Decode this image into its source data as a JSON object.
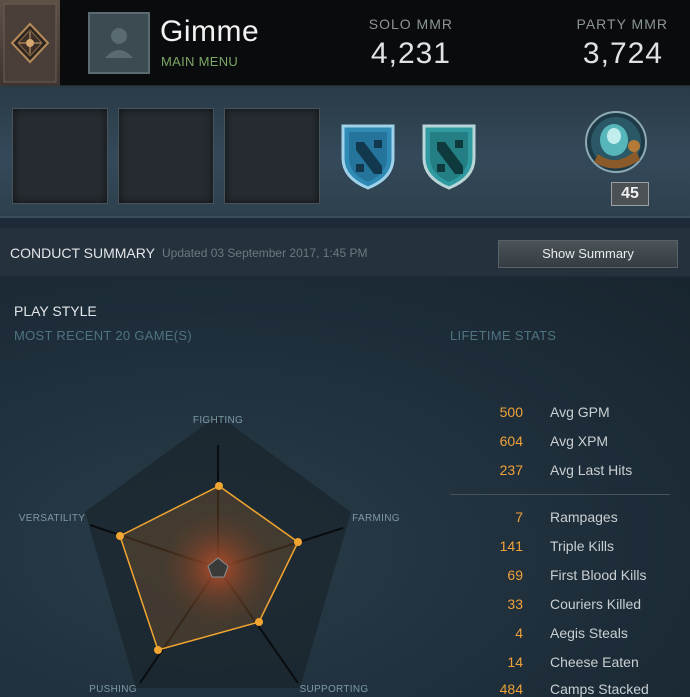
{
  "header": {
    "player_name": "Gimme",
    "status": "MAIN MENU",
    "solo_mmr_label": "SOLO MMR",
    "solo_mmr_value": "4,231",
    "party_mmr_label": "PARTY MMR",
    "party_mmr_value": "3,724"
  },
  "badges": {
    "hero_level": "45"
  },
  "conduct": {
    "title": "CONDUCT SUMMARY",
    "updated": "Updated 03 September 2017, 1:45 PM",
    "button_label": "Show Summary"
  },
  "playstyle": {
    "title": "PLAY STYLE",
    "recent_label": "MOST RECENT 20 GAME(S)",
    "lifetime_label": "LIFETIME STATS",
    "axes": [
      "FIGHTING",
      "FARMING",
      "SUPPORTING",
      "PUSHING",
      "VERSATILITY"
    ],
    "colors": {
      "accent": "#f0a23a",
      "radar_line": "#f2a530"
    }
  },
  "lifetime_stats": {
    "averages": [
      {
        "value": "500",
        "label": "Avg GPM"
      },
      {
        "value": "604",
        "label": "Avg XPM"
      },
      {
        "value": "237",
        "label": "Avg Last Hits"
      }
    ],
    "totals": [
      {
        "value": "7",
        "label": "Rampages"
      },
      {
        "value": "141",
        "label": "Triple Kills"
      },
      {
        "value": "69",
        "label": "First Blood Kills"
      },
      {
        "value": "33",
        "label": "Couriers Killed"
      },
      {
        "value": "4",
        "label": "Aegis Steals"
      },
      {
        "value": "14",
        "label": "Cheese Eaten"
      },
      {
        "value": "484",
        "label": "Camps Stacked"
      }
    ]
  }
}
